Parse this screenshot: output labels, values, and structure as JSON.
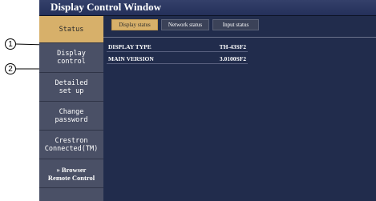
{
  "window": {
    "title": "Display Control Window"
  },
  "sidebar": {
    "items": [
      {
        "label": "Status",
        "active": true
      },
      {
        "label": "Display\ncontrol",
        "active": false
      },
      {
        "label": "Detailed\nset up",
        "active": false
      },
      {
        "label": "Change\npassword",
        "active": false
      },
      {
        "label": "Crestron\nConnected(TM)",
        "active": false
      },
      {
        "label": "» Browser\nRemote Control",
        "active": false
      }
    ]
  },
  "tabs": [
    {
      "label": "Display status",
      "active": true
    },
    {
      "label": "Network status",
      "active": false
    },
    {
      "label": "Input status",
      "active": false
    }
  ],
  "info": [
    {
      "label": "DISPLAY TYPE",
      "value": "TH-43SF2"
    },
    {
      "label": "MAIN VERSION",
      "value": "3.0100SF2"
    }
  ],
  "callouts": [
    "1",
    "2"
  ],
  "colors": {
    "accent": "#d7b06a",
    "background": "#212c4c",
    "sidebar": "#4a5066"
  }
}
